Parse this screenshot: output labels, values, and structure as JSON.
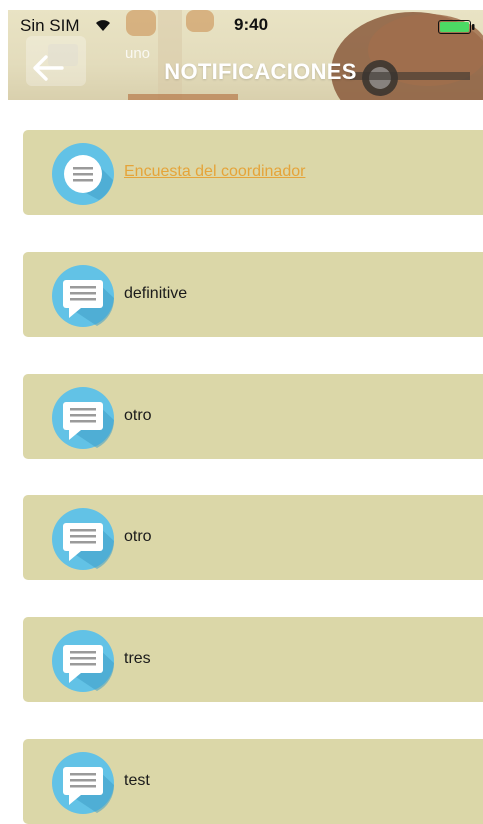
{
  "status_bar": {
    "carrier": "Sin SIM",
    "time": "9:40"
  },
  "header": {
    "title": "NOTIFICACIONES",
    "back_icon": "arrow-left-icon",
    "background_item_label": "uno"
  },
  "notifications": [
    {
      "label": "Encuesta del coordinador",
      "style": "link",
      "icon": "chat-bubble-icon"
    },
    {
      "label": "definitive",
      "style": "normal",
      "icon": "chat-bubble-icon"
    },
    {
      "label": "otro",
      "style": "normal",
      "icon": "chat-bubble-icon"
    },
    {
      "label": "otro",
      "style": "normal",
      "icon": "chat-bubble-icon"
    },
    {
      "label": "tres",
      "style": "normal",
      "icon": "chat-bubble-icon"
    },
    {
      "label": "test",
      "style": "normal",
      "icon": "chat-bubble-icon"
    }
  ],
  "colors": {
    "card_background": "#dbd7a8",
    "icon_circle": "#62c2e6",
    "icon_shadow": "#3f9fc6",
    "link_text": "#e5a43a",
    "title_text": "#ffffff"
  }
}
